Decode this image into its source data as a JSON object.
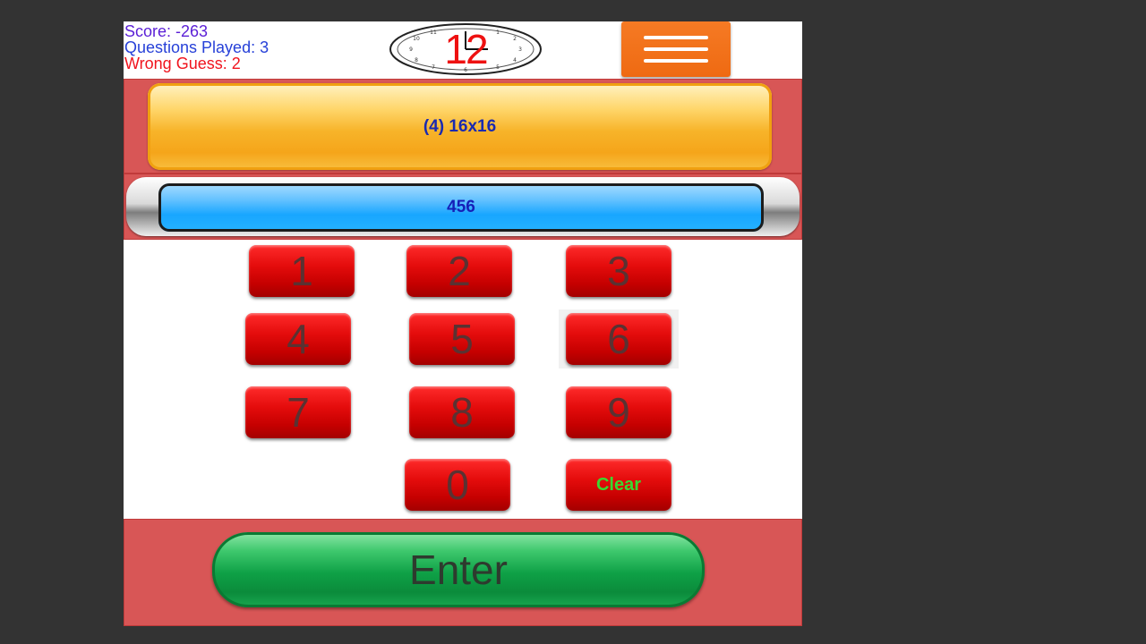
{
  "header": {
    "score": "Score: -263",
    "questions_played": "Questions Played: 3",
    "wrong_guess": "Wrong Guess: 2",
    "timer": "12"
  },
  "question": {
    "text": "(4) 16x16"
  },
  "answer": {
    "text": "456"
  },
  "keypad": {
    "k1": "1",
    "k2": "2",
    "k3": "3",
    "k4": "4",
    "k5": "5",
    "k6": "6",
    "k7": "7",
    "k8": "8",
    "k9": "9",
    "k0": "0",
    "clear": "Clear"
  },
  "enter_label": "Enter",
  "icons": {
    "menu": "hamburger-menu-icon",
    "timer": "clock-icon"
  },
  "colors": {
    "score": "#5b1fd6",
    "played": "#2741d8",
    "wrong": "#f0141e",
    "panel": "#d85656",
    "menu": "#ef6a12",
    "key": "#e40c0c",
    "enter": "#0ea046"
  }
}
